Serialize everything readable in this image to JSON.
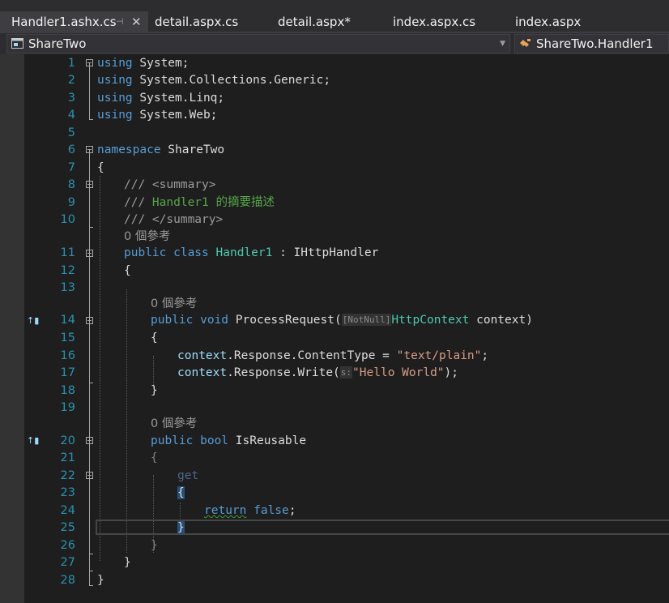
{
  "tabs": [
    {
      "label": "Handler1.ashx.cs",
      "active": true
    },
    {
      "label": "detail.aspx.cs"
    },
    {
      "label": "detail.aspx*"
    },
    {
      "label": "index.aspx.cs"
    },
    {
      "label": "index.aspx"
    }
  ],
  "tab_icons": {
    "pin": "⊣",
    "close": "✕"
  },
  "navbar": {
    "project": "ShareTwo",
    "member": "ShareTwo.Handler1",
    "project_icon": "project-icon",
    "member_icon": "class-icon"
  },
  "ref_counts": {
    "class": "0 個參考",
    "process_request": "0 個參考",
    "is_reusable": "0 個參考"
  },
  "line_numbers": [
    "1",
    "2",
    "3",
    "4",
    "5",
    "6",
    "7",
    "8",
    "9",
    "10",
    "11",
    "12",
    "13",
    "14",
    "15",
    "16",
    "17",
    "18",
    "19",
    "20",
    "21",
    "22",
    "23",
    "24",
    "25",
    "26",
    "27",
    "28"
  ],
  "code": {
    "l1": [
      "using",
      " System;"
    ],
    "l2": [
      "using",
      " System.Collections.Generic;"
    ],
    "l3": [
      "using",
      " System.Linq;"
    ],
    "l4": [
      "using",
      " System.Web;"
    ],
    "l6": [
      "namespace",
      " ShareTwo"
    ],
    "l7": "{",
    "l8": [
      "///",
      " <summary>"
    ],
    "l9": [
      "///",
      " Handler1 的摘要描述"
    ],
    "l10": [
      "///",
      " </summary>"
    ],
    "l11": [
      "public",
      " class",
      " Handler1",
      " : IHttpHandler"
    ],
    "l12": "{",
    "l14": [
      "public",
      " void",
      " ProcessRequest(",
      "[NotNull]",
      "HttpContext",
      " context)"
    ],
    "l15": "{",
    "l16": [
      "context",
      ".Response.ContentType = ",
      "\"text/plain\"",
      ";"
    ],
    "l17": [
      "context",
      ".Response.Write(",
      "s:",
      "\"Hello World\"",
      ");"
    ],
    "l18": "}",
    "l20": [
      "public",
      " bool",
      " IsReusable"
    ],
    "l21": "{",
    "l22": "get",
    "l23": "{",
    "l24": [
      "return",
      " false",
      ";"
    ],
    "l25": "}",
    "l26": "}",
    "l27": "}",
    "l28": "}"
  },
  "colors": {
    "keyword": "#569cd6",
    "type": "#4ec9b0",
    "string": "#d69d85",
    "comment": "#57a64a",
    "line_number": "#2b91af",
    "background": "#1e1e1e"
  }
}
